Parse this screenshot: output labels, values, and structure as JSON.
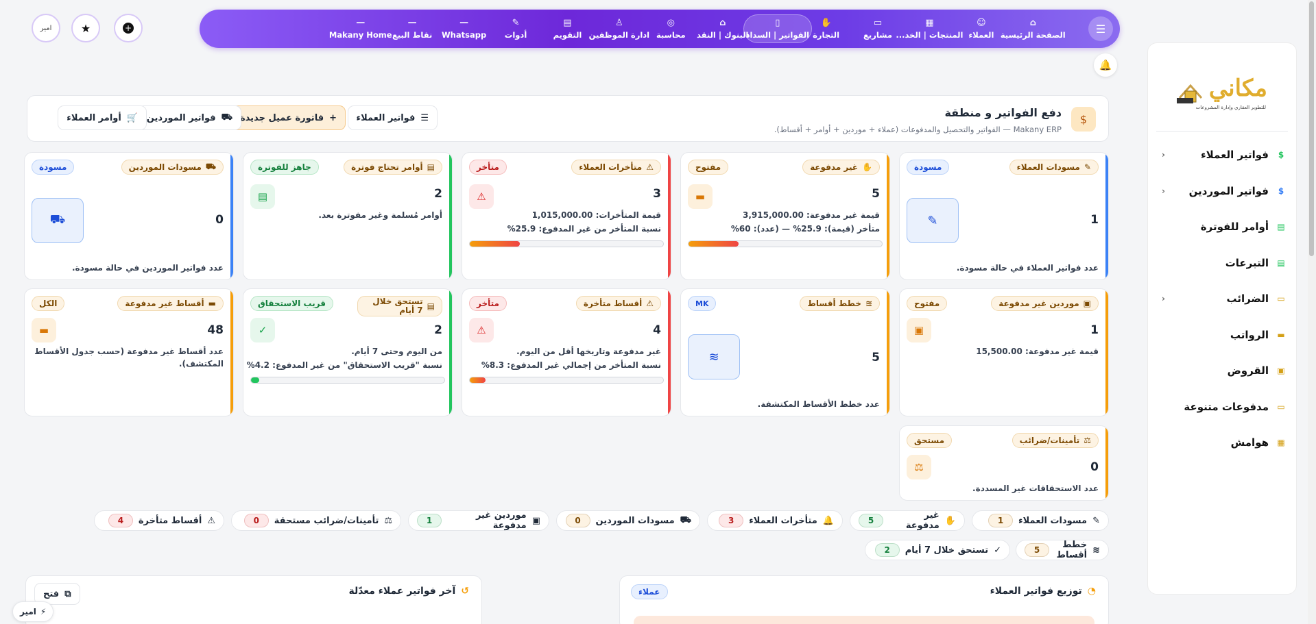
{
  "sidebar": {
    "logo_text": "مكاني",
    "logo_tag": "للتطوير العقاري وإدارة المشروعات",
    "items": [
      {
        "label": "فواتير العملاء",
        "icon": "invoice-icon",
        "chevron": true
      },
      {
        "label": "فواتير الموردين",
        "icon": "invoice-icon",
        "chevron": true
      },
      {
        "label": "أوامر للفوترة",
        "icon": "document-icon",
        "chevron": false
      },
      {
        "label": "التبرعات",
        "icon": "document-icon",
        "chevron": false
      },
      {
        "label": "الضرائب",
        "icon": "receipt-icon",
        "chevron": true
      },
      {
        "label": "الرواتب",
        "icon": "folder-icon",
        "chevron": false
      },
      {
        "label": "القروض",
        "icon": "money-icon",
        "chevron": false
      },
      {
        "label": "مدفوعات متنوعة",
        "icon": "receipt-icon",
        "chevron": false
      },
      {
        "label": "هوامش",
        "icon": "calculator-icon",
        "chevron": false
      }
    ]
  },
  "topnav": {
    "items": [
      {
        "label": "الصفحة الرئيسية",
        "icon": "⌂"
      },
      {
        "label": "العملاء",
        "icon": "☺"
      },
      {
        "label": "المنتجات | الخد...",
        "icon": "▦"
      },
      {
        "label": "مشاريع",
        "icon": "▭"
      },
      {
        "label": "التجارة",
        "icon": "✋"
      },
      {
        "label": "الفواتير | السداد",
        "icon": "▯"
      },
      {
        "label": "البنوك | النقد",
        "icon": "⌂"
      },
      {
        "label": "محاسبة",
        "icon": "◎"
      },
      {
        "label": "ادارة الموظفين",
        "icon": "♙"
      },
      {
        "label": "التقويم",
        "icon": "▤"
      },
      {
        "label": "أدوات",
        "icon": "✎"
      },
      {
        "label": "Whatsapp",
        "icon": "—"
      },
      {
        "label": "نقاط البيع",
        "icon": "—"
      },
      {
        "label": "Makany Home",
        "icon": "—"
      }
    ],
    "avatar_text": "امير"
  },
  "header": {
    "title": "دفع الفواتير و منطقة",
    "subtitle": "Makany ERP — الفواتير والتحصيل والمدفوعات (عملاء + موردين + أوامر + أقساط).",
    "buttons": {
      "customer_invoices": "فواتير العملاء",
      "new_invoice": "فاتورة عميل جديدة",
      "supplier_invoices": "فواتير الموردين",
      "customer_orders": "أوامر العملاء"
    }
  },
  "cards": {
    "c1": {
      "title": "مسودات العملاء",
      "badge": "مسودة",
      "value": "1",
      "foot": "عدد فواتير العملاء في حالة مسودة."
    },
    "c2": {
      "title": "غير مدفوعة",
      "badge": "مفتوح",
      "value": "5",
      "line1": "قيمة غير مدفوعة: 3,915,000.00",
      "line2": "متأخر (قيمة): 25.9% — (عدد): 60%",
      "progress": 0.259
    },
    "c3": {
      "title": "متأخرات العملاء",
      "badge": "متأخر",
      "value": "3",
      "line1": "قيمة المتأخرات: 1,015,000.00",
      "line2": "نسبة المتأخر من غير المدفوع: 25.9%",
      "progress": 0.259
    },
    "c4": {
      "title": "أوامر تحتاج فوترة",
      "badge": "جاهز للفوترة",
      "value": "2",
      "line1": "أوامر مُسلمة وغير مفوترة بعد."
    },
    "c5": {
      "title": "مسودات الموردين",
      "badge": "مسودة",
      "value": "0",
      "foot": "عدد فواتير الموردين في حالة مسودة."
    },
    "c6": {
      "title": "موردين غير مدفوعة",
      "badge": "مفتوح",
      "value": "1",
      "line1": "قيمة غير مدفوعة: 15,500.00"
    },
    "c7": {
      "title": "خطط أقساط",
      "badge": "MK",
      "value": "5",
      "foot": "عدد خطط الأقساط المكتشفة."
    },
    "c8": {
      "title": "أقساط متأخرة",
      "badge": "متأخر",
      "value": "4",
      "line1": "غير مدفوعة وتاريخها أقل من اليوم.",
      "line2": "نسبة المتأخر من إجمالي غير المدفوع: 8.3%",
      "progress": 0.083
    },
    "c9": {
      "title": "تستحق خلال 7 أيام",
      "badge": "قريب الاستحقاق",
      "value": "2",
      "line1": "من اليوم وحتى 7 أيام.",
      "line2": "نسبة \"قريب الاستحقاق\" من غير المدفوع: 4.2%",
      "progress": 0.042
    },
    "c10": {
      "title": "أقساط غير مدفوعة",
      "badge": "الكل",
      "value": "48",
      "line1": "عدد أقساط غير مدفوعة (حسب جدول الأقساط",
      "line2": "المكتشف)."
    },
    "c11": {
      "title": "تأمينات/ضرائب",
      "badge": "مستحق",
      "value": "0",
      "foot": "عدد الاستحقاقات غير المسددة."
    }
  },
  "chips": [
    {
      "label": "مسودات العملاء",
      "count": "1"
    },
    {
      "label": "غير مدفوعة",
      "count": "5"
    },
    {
      "label": "متأخرات العملاء",
      "count": "3"
    },
    {
      "label": "مسودات الموردين",
      "count": "0"
    },
    {
      "label": "موردين غير مدفوعة",
      "count": "1"
    },
    {
      "label": "تأمينات/ضرائب مستحقة",
      "count": "0"
    },
    {
      "label": "أقساط متأخرة",
      "count": "4"
    },
    {
      "label": "خطط أقساط",
      "count": "5"
    },
    {
      "label": "تستحق خلال 7 أيام",
      "count": "2"
    }
  ],
  "panels": {
    "distribution_title": "توزيع فواتير العملاء",
    "distribution_badge": "عملاء",
    "recent_title": "آخر فواتير عملاء معدّلة",
    "open_button": "فتح"
  },
  "float_user": "امير",
  "colors": {
    "accent": "#7c3aed",
    "blue": "#3b82f6",
    "orange": "#f59e0b",
    "red": "#ef4444",
    "green": "#22c55e"
  }
}
